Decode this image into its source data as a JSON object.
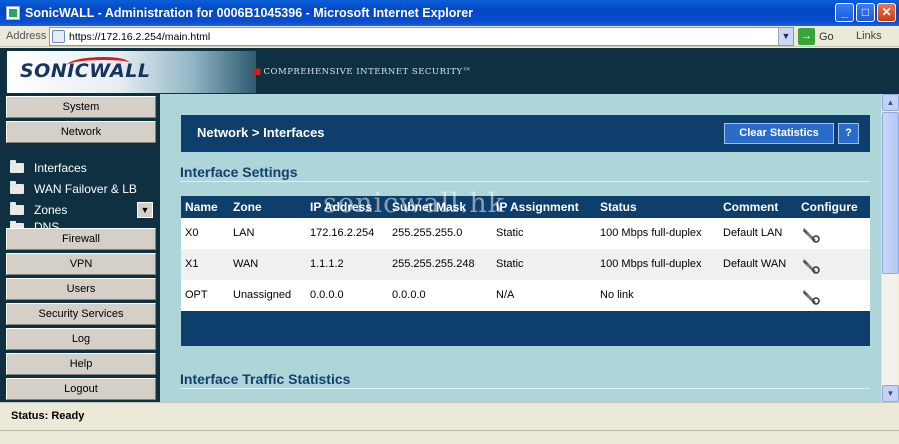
{
  "window": {
    "title": "SonicWALL - Administration for 0006B1045396 - Microsoft Internet Explorer",
    "buttons": {
      "minimize": "_",
      "maximize": "□",
      "close": "✕"
    }
  },
  "addressbar": {
    "label": "Address",
    "url": "https://172.16.2.254/main.html",
    "go_label": "Go",
    "links_label": "Links"
  },
  "banner": {
    "logo": "SONICWALL",
    "tagline": "COMPREHENSIVE INTERNET SECURITY™"
  },
  "nav": {
    "top_items": [
      "System",
      "Network"
    ],
    "sub_items": [
      "Interfaces",
      "WAN Failover & LB",
      "Zones",
      "DNS"
    ],
    "bottom_items": [
      "Firewall",
      "VPN",
      "Users",
      "Security Services",
      "Log",
      "Help",
      "Logout"
    ]
  },
  "main": {
    "breadcrumb": "Network > Interfaces",
    "clear_stats_label": "Clear Statistics",
    "help_label": "?",
    "section1_title": "Interface Settings",
    "section2_title": "Interface Traffic Statistics",
    "watermark": "sonicwall.hk",
    "table": {
      "headers": [
        "Name",
        "Zone",
        "IP Address",
        "Subnet Mask",
        "IP Assignment",
        "Status",
        "Comment",
        "Configure"
      ],
      "rows": [
        {
          "name": "X0",
          "zone": "LAN",
          "ip": "172.16.2.254",
          "mask": "255.255.255.0",
          "assign": "Static",
          "status": "100 Mbps full-duplex",
          "comment": "Default LAN"
        },
        {
          "name": "X1",
          "zone": "WAN",
          "ip": "1.1.1.2",
          "mask": "255.255.255.248",
          "assign": "Static",
          "status": "100 Mbps full-duplex",
          "comment": "Default WAN"
        },
        {
          "name": "OPT",
          "zone": "Unassigned",
          "ip": "0.0.0.0",
          "mask": "0.0.0.0",
          "assign": "N/A",
          "status": "No link",
          "comment": ""
        }
      ]
    }
  },
  "statusbar": {
    "label": "Status:",
    "value": "Ready"
  },
  "colors": {
    "nav_bg": "#0e3040",
    "content_bg": "#aed6d9",
    "header_blue": "#0e3e6b",
    "section_title": "#133f6e"
  }
}
